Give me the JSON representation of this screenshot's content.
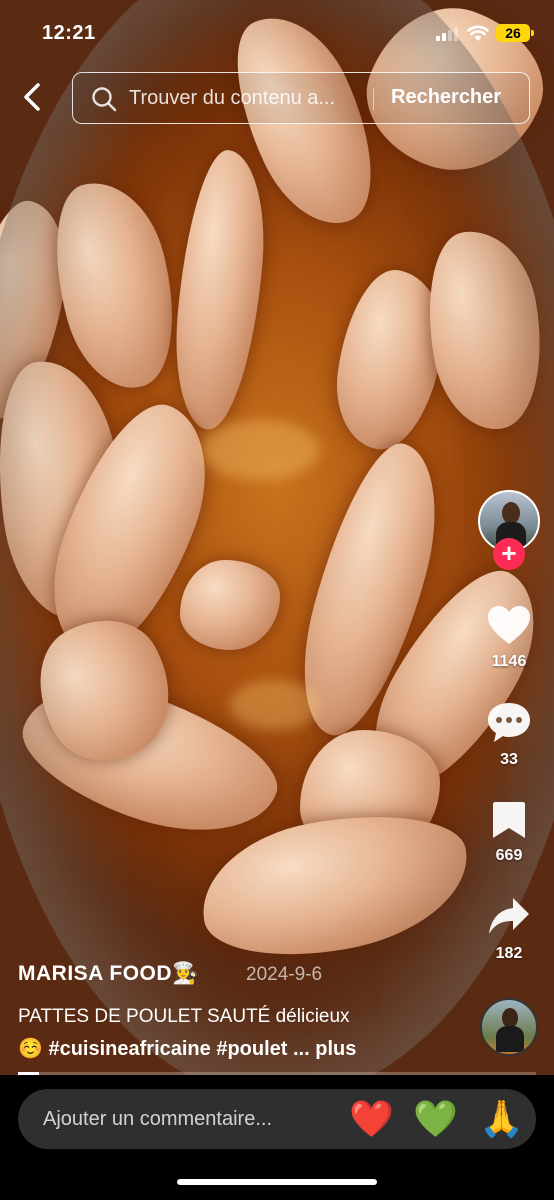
{
  "status_bar": {
    "time": "12:21",
    "battery": "26"
  },
  "top_bar": {
    "search_placeholder": "Trouver du contenu a...",
    "search_button": "Rechercher"
  },
  "rail": {
    "likes": "1146",
    "comments": "33",
    "saves": "669",
    "shares": "182",
    "follow_symbol": "+"
  },
  "post": {
    "author": "MARISA  FOOD👩‍🍳",
    "date": "2024-9-6",
    "caption_line1": "PATTES DE POULET SAUTÉ délicieux",
    "caption_line2": "☺️ #cuisineafricaine #poulet ...",
    "more": "plus",
    "progress": 0.04
  },
  "comment_bar": {
    "placeholder": "Ajouter un commentaire...",
    "emojis": [
      "❤️",
      "💚",
      "🙏"
    ]
  },
  "colors": {
    "accent": "#fe2c55",
    "battery": "#ffd60a"
  },
  "icons": [
    "back-chevron-icon",
    "search-icon",
    "heart-icon",
    "comment-icon",
    "bookmark-icon",
    "share-icon"
  ]
}
